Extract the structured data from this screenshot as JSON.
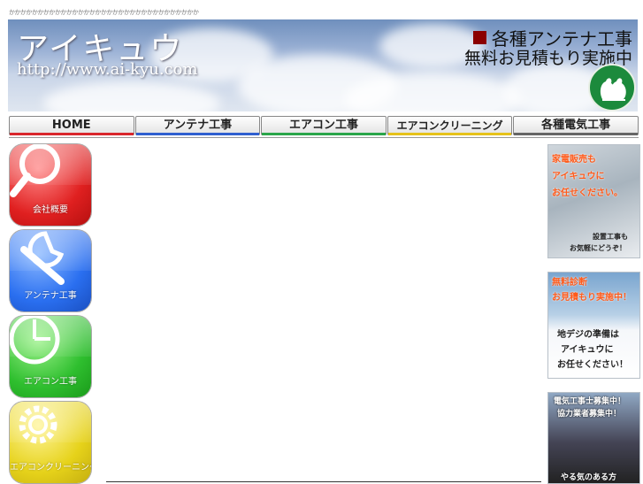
{
  "top_note": "かかかかかかかかかかかかかかかかかかかかかかかかかかかかかかかかか",
  "header": {
    "logo": "アイキュウ",
    "url": "http://www.ai-kyu.com",
    "promo_line1": "各種アンテナ工事",
    "promo_line2": "無料お見積もり実施中",
    "badge_icon": "two-birds-icon",
    "square_color": "#8b0000"
  },
  "nav": [
    {
      "label": "HOME",
      "color": "#d9262c"
    },
    {
      "label": "アンテナ工事",
      "color": "#2f5fd0"
    },
    {
      "label": "エアコン工事",
      "color": "#2aa64a"
    },
    {
      "label": "エアコンクリーニング",
      "color": "#e6c21a"
    },
    {
      "label": "各種電気工事",
      "color": "#666666"
    }
  ],
  "sidebar": [
    {
      "label": "会社概要",
      "icon": "magnifier-icon",
      "color": "red"
    },
    {
      "label": "アンテナ工事",
      "icon": "wrench-icon",
      "color": "blue"
    },
    {
      "label": "エアコン工事",
      "icon": "clock-icon",
      "color": "green"
    },
    {
      "label": "エアコンクリーニング",
      "icon": "gear-icon",
      "color": "yellow"
    }
  ],
  "banners": {
    "b1": {
      "line1": "家電販売も",
      "line2": "アイキュウに",
      "line3": "お任せください。",
      "sub1": "設置工事も",
      "sub2": "お気軽にどうぞ！"
    },
    "b2": {
      "line1": "無料診断",
      "line2": "お見積もり実施中！",
      "line3": "地デジの準備は",
      "line4": "アイキュウに",
      "line5": "お任せください！"
    },
    "b3": {
      "line1": "電気工事士募集中！",
      "line2": "協力業者募集中！",
      "line3": "やる気のある方"
    }
  }
}
